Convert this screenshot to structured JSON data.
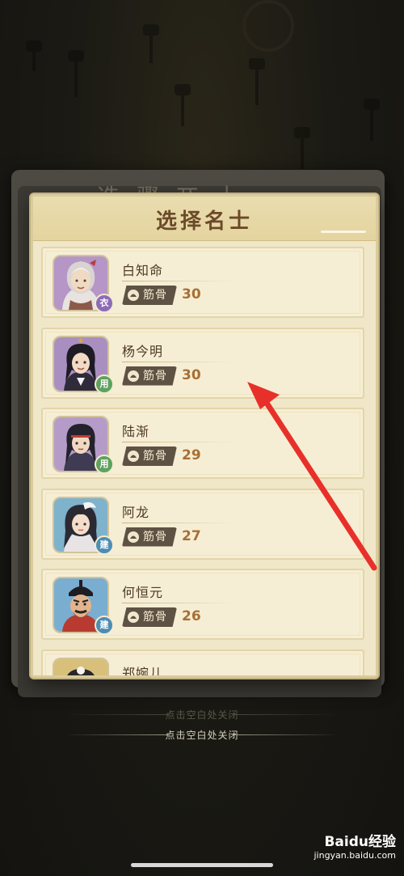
{
  "modal": {
    "title": "选择名士",
    "ghost_title": "选 骤 兀 士"
  },
  "stat_label": "筋骨",
  "characters": [
    {
      "name": "白知命",
      "badge": "衣",
      "badge_color": "#8d6bb7",
      "value": "30",
      "portrait": "white-hair-elder"
    },
    {
      "name": "杨今明",
      "badge": "用",
      "badge_color": "#5da25e",
      "value": "30",
      "portrait": "young-black-hair"
    },
    {
      "name": "陆渐",
      "badge": "用",
      "badge_color": "#5da25e",
      "value": "29",
      "portrait": "headband-young"
    },
    {
      "name": "阿龙",
      "badge": "建",
      "badge_color": "#4c8db5",
      "value": "27",
      "portrait": "white-ornament-long-hair"
    },
    {
      "name": "何恒元",
      "badge": "建",
      "badge_color": "#4c8db5",
      "value": "26",
      "portrait": "bearded-official"
    },
    {
      "name": "郑婉儿",
      "badge": "",
      "badge_color": "#4c8db5",
      "value": "",
      "portrait": "flower-hair"
    }
  ],
  "hints": {
    "faded": "点击空白处关闭",
    "current": "点击空白处关闭"
  },
  "annotation_arrow_color": "#e8302a",
  "watermark": {
    "brand": "Baidu经验",
    "url": "jingyan.baidu.com"
  }
}
